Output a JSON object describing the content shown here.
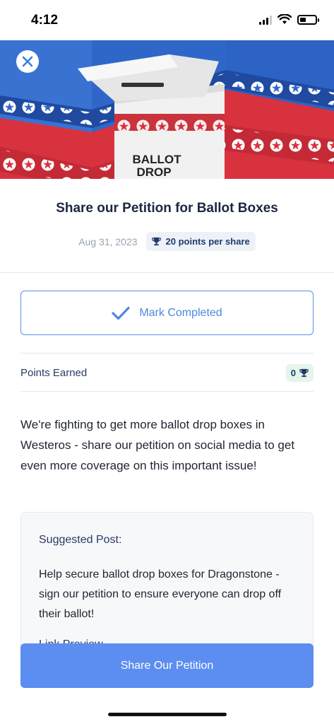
{
  "status_bar": {
    "time": "4:12",
    "battery_level": 0.35
  },
  "hero": {
    "box_text_line1": "BALLOT",
    "box_text_line2": "DROP",
    "colors": {
      "blue": "#2f67c9",
      "red": "#d8323f",
      "white": "#ffffff"
    }
  },
  "header": {
    "title": "Share our Petition for Ballot Boxes",
    "date": "Aug 31, 2023",
    "points_per_share": "20 points per share"
  },
  "actions": {
    "mark_completed": "Mark Completed",
    "share": "Share Our Petition"
  },
  "points": {
    "label": "Points Earned",
    "value": "0"
  },
  "description": "We're fighting to get more ballot drop boxes in Westeros - share our petition on social media to get even more coverage on this important issue!",
  "suggested_post": {
    "title": "Suggested Post:",
    "body": "Help secure ballot drop boxes for Dragonstone - sign our petition to ensure everyone can drop off their ballot!",
    "link_label": "Link Preview"
  },
  "colors": {
    "accent": "#5b8ef0",
    "accent_border": "#5a8ee8",
    "heading": "#1c2740"
  }
}
